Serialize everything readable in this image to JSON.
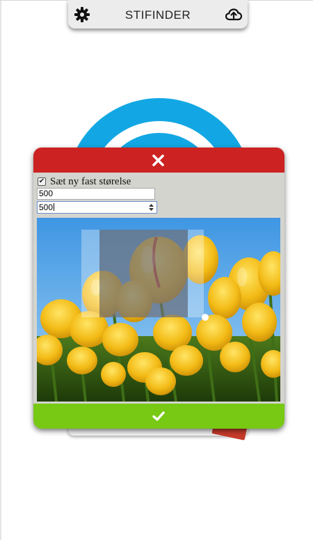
{
  "header": {
    "title": "STIFINDER",
    "settings_icon": "gear-icon",
    "upload_icon": "cloud-upload-icon"
  },
  "dialog": {
    "close_icon": "close-icon",
    "checkbox_label": "Sæt ny fast størelse",
    "checkbox_checked": true,
    "width_value": "500",
    "height_value": "500",
    "image_subject": "yellow tulips",
    "confirm_icon": "checkmark-icon"
  },
  "colors": {
    "header_bg": "#ececec",
    "dialog_header": "#cc2222",
    "confirm_bar": "#77c914",
    "dialog_body": "#d4d4cf",
    "logo_blue": "#12a7e4"
  }
}
